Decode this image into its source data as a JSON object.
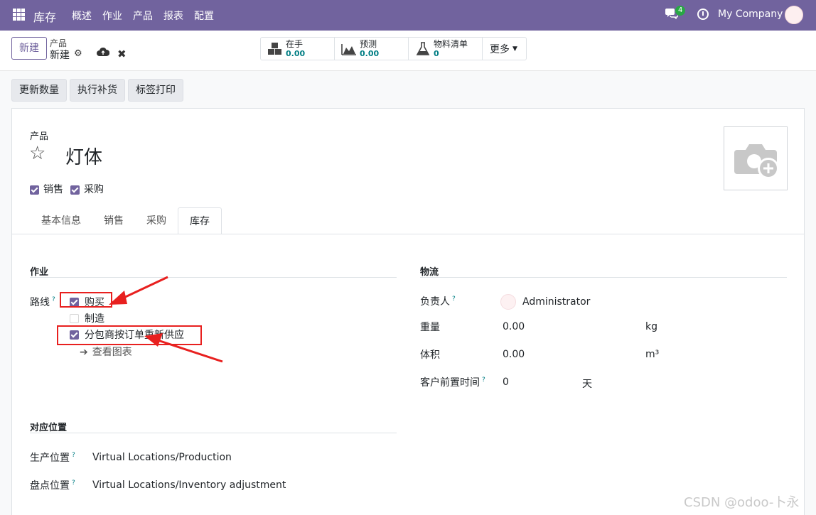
{
  "topnav": {
    "app_title": "库存",
    "menu": [
      "概述",
      "作业",
      "产品",
      "报表",
      "配置"
    ],
    "chat_count": "4",
    "company": "My Company",
    "color": "#71639e"
  },
  "control": {
    "new_button": "新建",
    "breadcrumb_parent": "产品",
    "breadcrumb_current": "新建",
    "smart_buttons": [
      {
        "label": "在手",
        "value": "0.00",
        "icon": "cubes-icon"
      },
      {
        "label": "预测",
        "value": "0.00",
        "icon": "area-chart-icon"
      },
      {
        "label": "物料清单",
        "value": "0",
        "icon": "flask-icon"
      }
    ],
    "more": "更多"
  },
  "actions": [
    "更新数量",
    "执行补货",
    "标签打印"
  ],
  "product": {
    "type_label": "产品",
    "name": "灯体",
    "can_sell_label": "销售",
    "can_purchase_label": "采购",
    "can_sell": true,
    "can_purchase": true
  },
  "tabs": [
    "基本信息",
    "销售",
    "采购",
    "库存"
  ],
  "active_tab": "库存",
  "operations": {
    "title": "作业",
    "routes_label": "路线",
    "routes": [
      {
        "label": "购买",
        "checked": true
      },
      {
        "label": "制造",
        "checked": false
      },
      {
        "label": "分包商按订单重新供应",
        "checked": true
      }
    ],
    "view_diagram": "查看图表"
  },
  "logistics": {
    "title": "物流",
    "responsible_label": "负责人",
    "responsible": "Administrator",
    "weight_label": "重量",
    "weight": "0.00",
    "weight_unit": "kg",
    "volume_label": "体积",
    "volume": "0.00",
    "volume_unit": "m³",
    "lead_label": "客户前置时间",
    "lead": "0",
    "lead_unit": "天"
  },
  "locations": {
    "title": "对应位置",
    "production_label": "生产位置",
    "production": "Virtual Locations/Production",
    "inventory_label": "盘点位置",
    "inventory": "Virtual Locations/Inventory adjustment"
  },
  "help_mark": "?",
  "watermark": "CSDN @odoo-卜永"
}
